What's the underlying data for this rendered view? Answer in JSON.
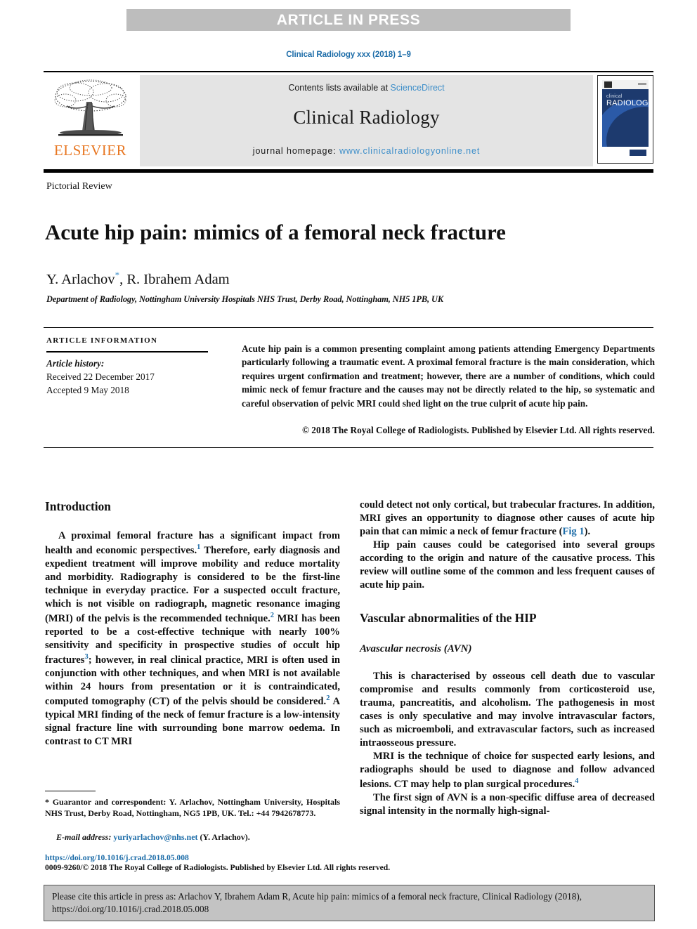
{
  "banner": {
    "text": "ARTICLE IN PRESS"
  },
  "journal_reference": "Clinical Radiology xxx (2018) 1–9",
  "masthead": {
    "contents_prefix": "Contents lists available at ",
    "contents_link": "ScienceDirect",
    "journal_name": "Clinical Radiology",
    "homepage_prefix": "journal homepage: ",
    "homepage_link": "www.clinicalradiologyonline.net",
    "publisher_logo_text": "ELSEVIER",
    "cover": {
      "line1": "clinical",
      "line2": "RADIOLOGY"
    }
  },
  "article": {
    "section_label": "Pictorial Review",
    "title": "Acute hip pain: mimics of a femoral neck fracture",
    "authors": "Y. Arlachov",
    "authors_rest": ", R. Ibrahem Adam",
    "corresponding_marker": "*",
    "affiliation": "Department of Radiology, Nottingham University Hospitals NHS Trust, Derby Road, Nottingham, NH5 1PB, UK"
  },
  "article_information": {
    "heading": "ARTICLE INFORMATION",
    "history_label": "Article history:",
    "received": "Received 22 December 2017",
    "accepted": "Accepted 9 May 2018"
  },
  "abstract": {
    "text": "Acute hip pain is a common presenting complaint among patients attending Emergency Departments particularly following a traumatic event. A proximal femoral fracture is the main consideration, which requires urgent confirmation and treatment; however, there are a number of conditions, which could mimic neck of femur fracture and the causes may not be directly related to the hip, so systematic and careful observation of pelvic MRI could shed light on the true culprit of acute hip pain.",
    "copyright": "© 2018 The Royal College of Radiologists. Published by Elsevier Ltd. All rights reserved."
  },
  "body": {
    "left": {
      "heading": "Introduction",
      "paragraph1_a": "A proximal femoral fracture has a significant impact from health and economic perspectives.",
      "ref1": "1",
      "paragraph1_b": " Therefore, early diagnosis and expedient treatment will improve mobility and reduce mortality and morbidity. Radiography is considered to be the first-line technique in everyday practice. For a suspected occult fracture, which is not visible on radiograph, magnetic resonance imaging (MRI) of the pelvis is the recommended technique.",
      "ref2": "2",
      "paragraph1_c": " MRI has been reported to be a cost-effective technique with nearly 100% sensitivity and specificity in prospective studies of occult hip fractures",
      "ref3": "3",
      "paragraph1_d": "; however, in real clinical practice, MRI is often used in conjunction with other techniques, and when MRI is not available within 24 hours from presentation or it is contraindicated, computed tomography (CT) of the pelvis should be considered.",
      "ref2b": "2",
      "paragraph1_e": " A typical MRI finding of the neck of femur fracture is a low-intensity signal fracture line with surrounding bone marrow oedema. In contrast to CT MRI"
    },
    "right": {
      "paragraph_cont_a": "could detect not only cortical, but trabecular fractures. In addition, MRI gives an opportunity to diagnose other causes of acute hip pain that can mimic a neck of femur fracture (",
      "fig_link": "Fig 1",
      "paragraph_cont_b": ").",
      "paragraph2": "Hip pain causes could be categorised into several groups according to the origin and nature of the causative process. This review will outline some of the common and less frequent causes of acute hip pain.",
      "heading": "Vascular abnormalities of the HIP",
      "subheading": "Avascular necrosis (AVN)",
      "paragraph3": "This is characterised by osseous cell death due to vascular compromise and results commonly from corticosteroid use, trauma, pancreatitis, and alcoholism. The pathogenesis in most cases is only speculative and may involve intravascular factors, such as microemboli, and extravascular factors, such as increased intraosseous pressure.",
      "paragraph4_a": "MRI is the technique of choice for suspected early lesions, and radiographs should be used to diagnose and follow advanced lesions. CT may help to plan surgical procedures.",
      "ref4": "4",
      "paragraph5": "The first sign of AVN is a non-specific diffuse area of decreased signal intensity in the normally high-signal-"
    }
  },
  "footnotes": {
    "guarantor": "* Guarantor and correspondent: Y. Arlachov, Nottingham University, Hospitals NHS Trust, Derby Road, Nottingham, NG5 1PB, UK. Tel.: +44 7942678773.",
    "email_label": "E-mail address:",
    "email": "yuriyarlachov@nhs.net",
    "email_suffix": "(Y. Arlachov).",
    "doi": "https://doi.org/10.1016/j.crad.2018.05.008",
    "issn_copyright": "0009-9260/© 2018 The Royal College of Radiologists. Published by Elsevier Ltd. All rights reserved."
  },
  "cite_box": {
    "line1": "Please cite this article in press as: Arlachov Y, Ibrahem Adam R, Acute hip pain: mimics of a femoral neck fracture, Clinical Radiology (2018),",
    "line2": "https://doi.org/10.1016/j.crad.2018.05.008"
  },
  "colors": {
    "link_blue": "#1c6ca8",
    "masthead_link": "#3d8ec9",
    "elsevier_orange": "#e87722",
    "banner_gray": "#bdbdbd",
    "masthead_gray": "#e4e4e4",
    "cite_box_gray": "#c3c3c3",
    "cover_navy": "#1d3a6e"
  }
}
